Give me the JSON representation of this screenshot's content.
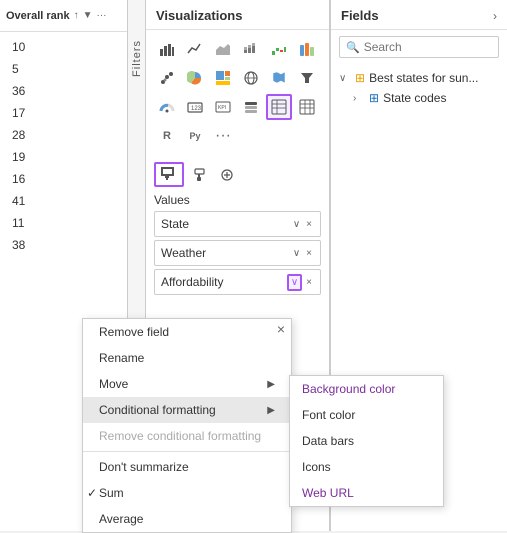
{
  "rank": {
    "header": "Overall rank",
    "sort_icon": "↑",
    "filter_icon": "▼",
    "more_icon": "···",
    "values": [
      "10",
      "5",
      "36",
      "17",
      "28",
      "19",
      "16",
      "41",
      "11",
      "38"
    ]
  },
  "visualizations": {
    "title": "Visualizations",
    "filters_label": "Filters"
  },
  "values_section": {
    "label": "Values",
    "fields": [
      {
        "name": "State",
        "has_chevron": true,
        "has_x": true
      },
      {
        "name": "Weather",
        "has_chevron": true,
        "has_x": true
      },
      {
        "name": "Affordability",
        "has_chevron": true,
        "has_x": true,
        "chevron_highlighted": true
      }
    ]
  },
  "context_menu": {
    "items": [
      {
        "label": "Remove field",
        "disabled": false,
        "has_submenu": false
      },
      {
        "label": "Rename",
        "disabled": false,
        "has_submenu": false
      },
      {
        "label": "Move",
        "disabled": false,
        "has_submenu": true
      },
      {
        "label": "Conditional formatting",
        "disabled": false,
        "has_submenu": true,
        "highlighted": true
      },
      {
        "label": "Remove conditional formatting",
        "disabled": true,
        "has_submenu": false
      },
      {
        "label": "Don't summarize",
        "disabled": false,
        "has_submenu": false
      },
      {
        "label": "Sum",
        "disabled": false,
        "has_submenu": false,
        "checked": true
      },
      {
        "label": "Average",
        "disabled": false,
        "has_submenu": false
      }
    ]
  },
  "submenu": {
    "items": [
      {
        "label": "Background color",
        "accent": true
      },
      {
        "label": "Font color",
        "accent": false
      },
      {
        "label": "Data bars",
        "accent": false
      },
      {
        "label": "Icons",
        "accent": false
      },
      {
        "label": "Web URL",
        "accent": false
      }
    ]
  },
  "fields": {
    "title": "Fields",
    "search_placeholder": "Search",
    "tree": [
      {
        "label": "Best states for sun...",
        "icon": "table",
        "color": "yellow",
        "expanded": true
      },
      {
        "label": "State codes",
        "icon": "table",
        "color": "blue",
        "expanded": false,
        "indent": true
      }
    ]
  },
  "icons": {
    "bar_chart": "▊",
    "line_chart": "📈",
    "area_chart": "◿",
    "stacked_bar": "▬",
    "scatter": "⊞",
    "pie": "◑",
    "treemap": "⊟",
    "funnel": "⊽",
    "gauge": "◎",
    "card": "▭",
    "table_icon": "⊞",
    "matrix": "⊟",
    "r_icon": "R",
    "py_icon": "Py",
    "more": "···",
    "map": "🌐",
    "filled_map": "▦",
    "map2": "◫",
    "kpi": "◨",
    "slicer": "◧",
    "waterfall": "◩",
    "ribbon": "◪",
    "qna": "💬"
  }
}
